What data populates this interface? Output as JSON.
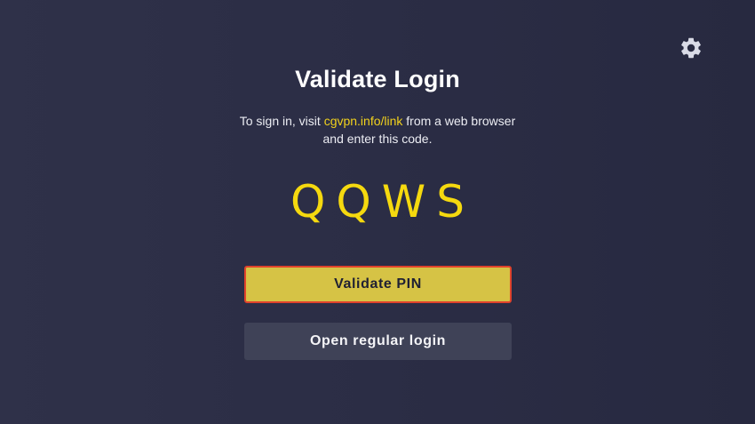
{
  "icons": {
    "settings": "gear-icon"
  },
  "colors": {
    "accent": "#f5d90f",
    "primary_button": "#d6c345",
    "focus_border": "#e0432c",
    "background": "#2b2d45",
    "secondary_button": "#3f4257"
  },
  "header": {
    "title": "Validate Login"
  },
  "instructions": {
    "prefix": "To sign in, visit ",
    "link": "cgvpn.info/link",
    "suffix": " from a web browser",
    "line2": "and enter this code."
  },
  "code": {
    "value": "QQWS"
  },
  "buttons": {
    "validate_pin": "Validate PIN",
    "open_regular_login": "Open regular login"
  }
}
